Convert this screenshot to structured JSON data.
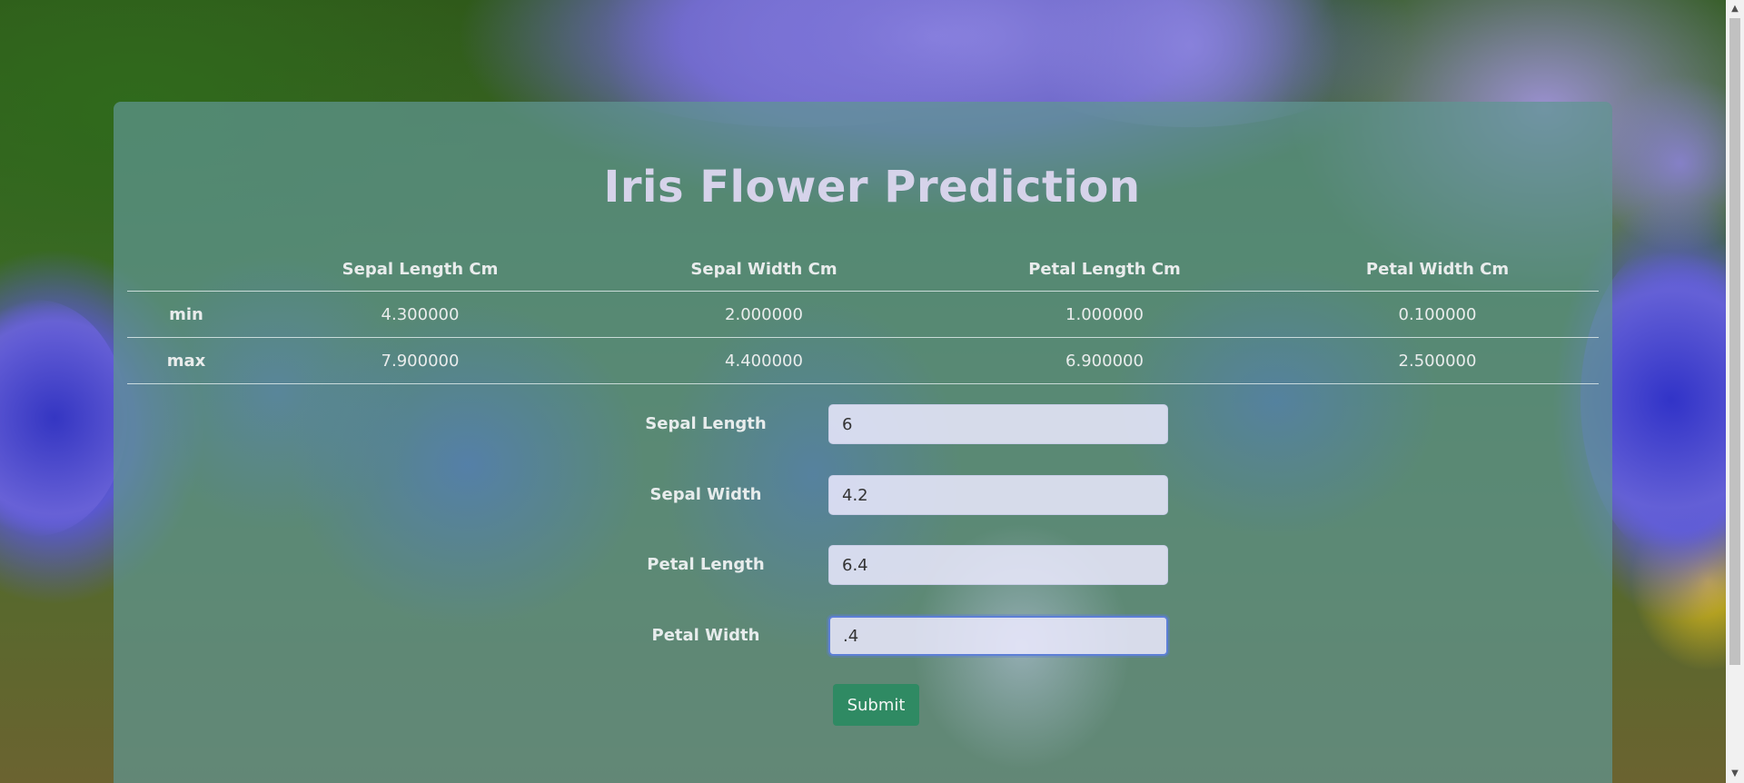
{
  "page": {
    "title": "Iris Flower Prediction"
  },
  "stats_table": {
    "columns": [
      "",
      "Sepal Length Cm",
      "Sepal Width Cm",
      "Petal Length Cm",
      "Petal Width Cm"
    ],
    "rows": [
      {
        "label": "min",
        "values": [
          "4.300000",
          "2.000000",
          "1.000000",
          "0.100000"
        ]
      },
      {
        "label": "max",
        "values": [
          "7.900000",
          "4.400000",
          "6.900000",
          "2.500000"
        ]
      }
    ]
  },
  "form": {
    "fields": [
      {
        "label": "Sepal Length",
        "value": "6"
      },
      {
        "label": "Sepal Width",
        "value": "4.2"
      },
      {
        "label": "Petal Length",
        "value": "6.4"
      },
      {
        "label": "Petal Width",
        "value": ".4"
      }
    ],
    "submit_label": "Submit"
  },
  "colors": {
    "card_overlay": "#5f9691",
    "submit_button": "#2f8a63",
    "title_text": "#d6d3ea",
    "input_background": "#eceaff",
    "focused_border": "#5d7fd6"
  },
  "icons": {
    "scroll_up": "triangle-up-icon",
    "scroll_down": "triangle-down-icon"
  }
}
